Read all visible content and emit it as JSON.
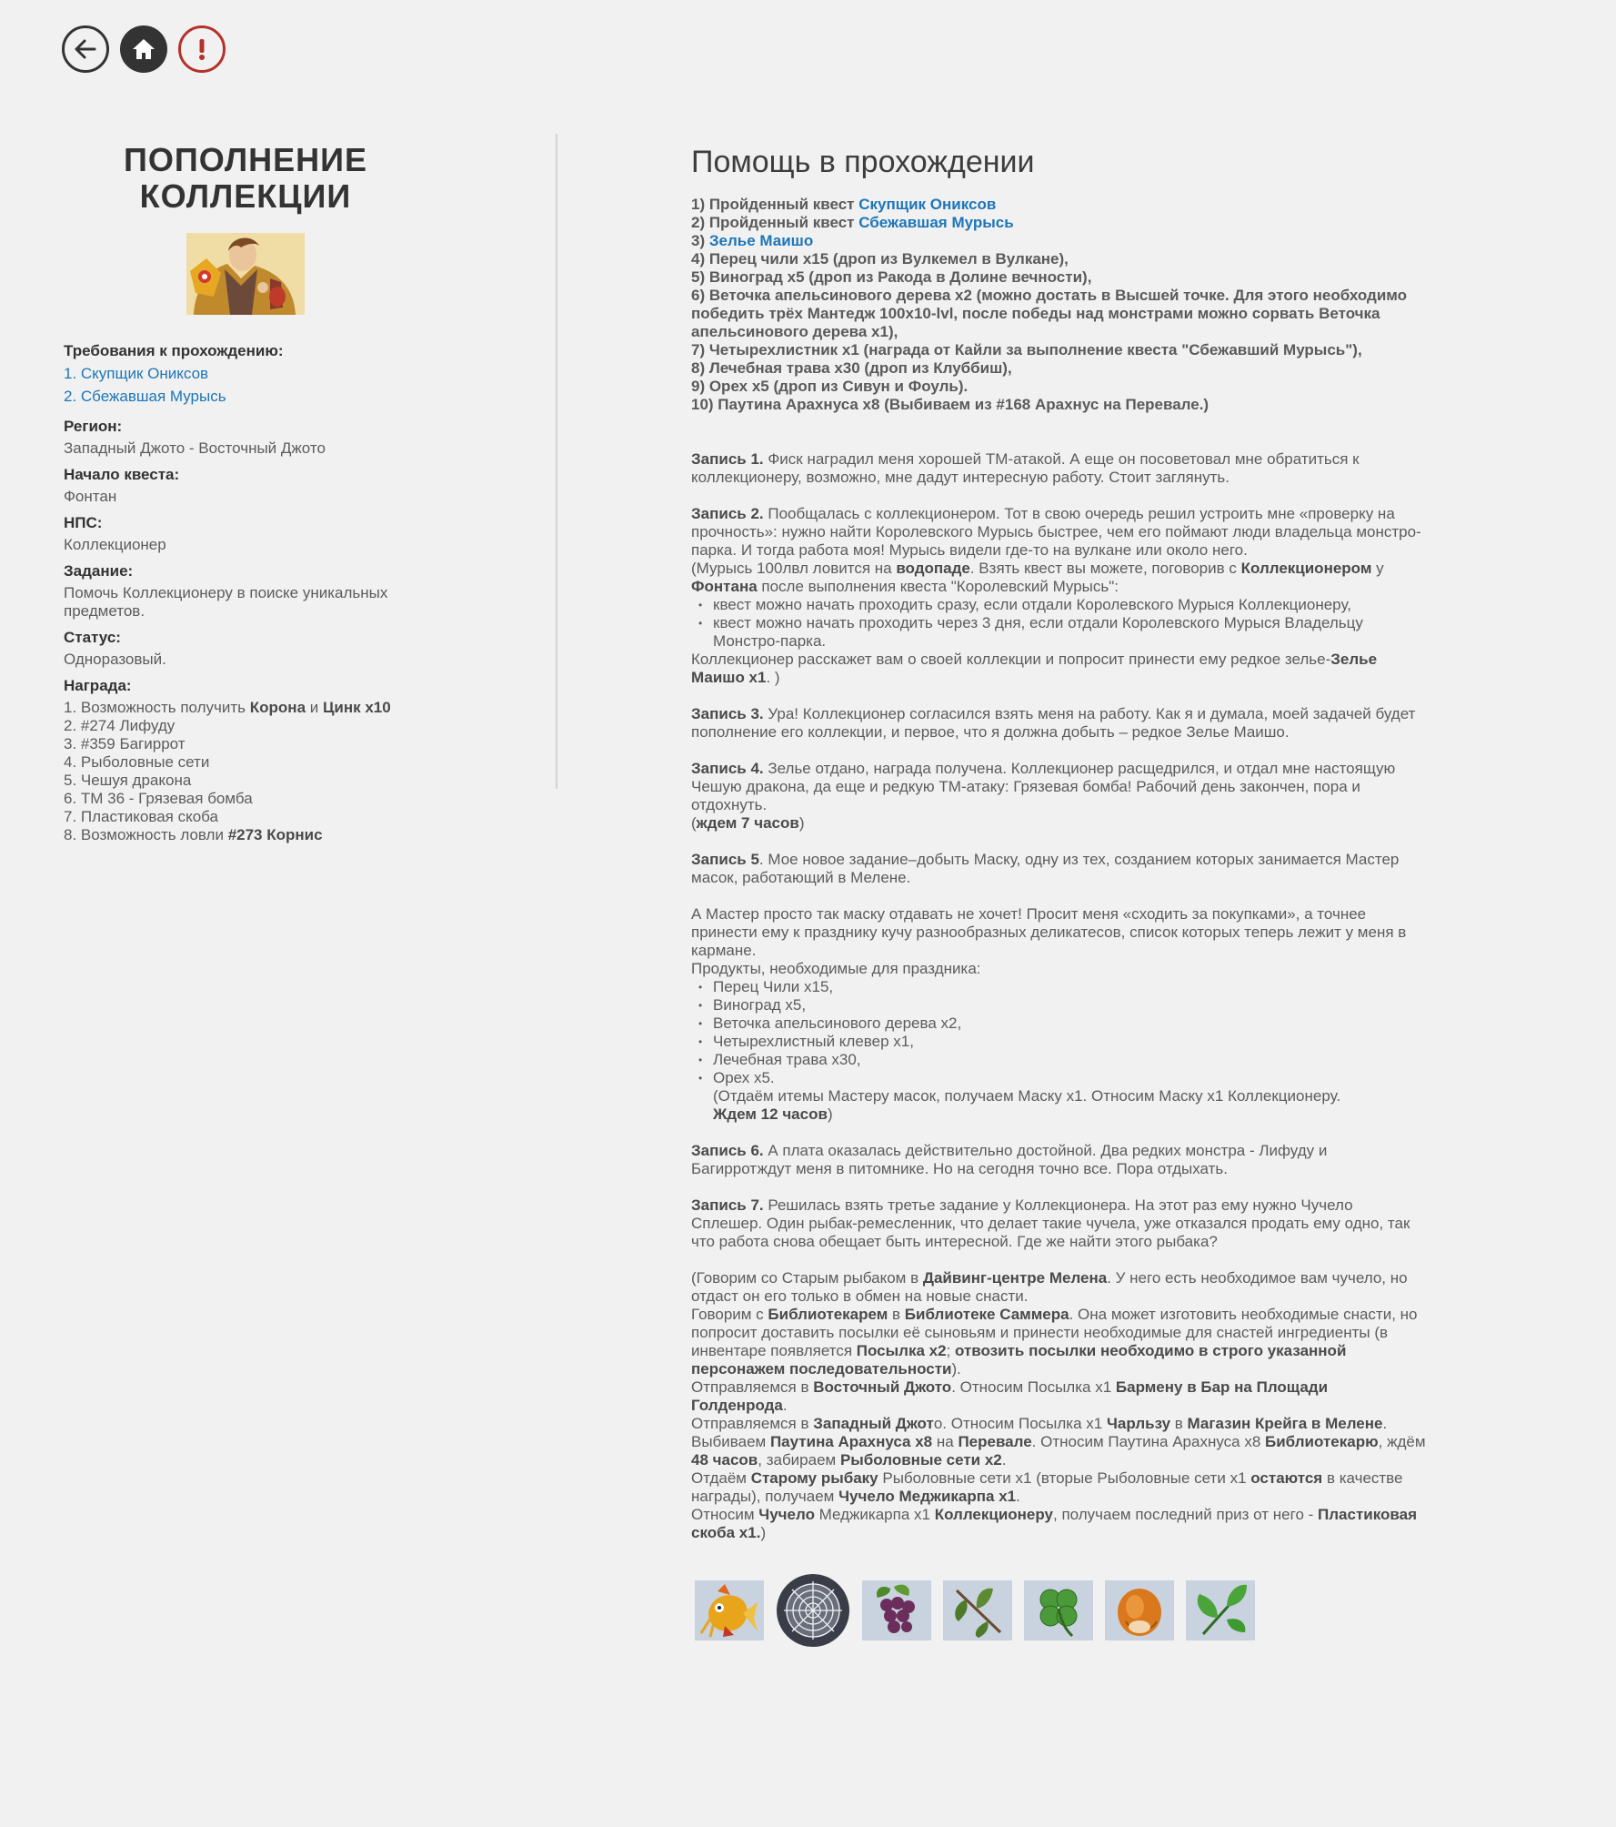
{
  "nav": {
    "back_icon": "arrow-left-icon",
    "home_icon": "home-icon",
    "alert_icon": "exclamation-icon"
  },
  "left": {
    "title_line1": "ПОПОЛНЕНИЕ",
    "title_line2": "КОЛЛЕКЦИИ",
    "requirements_label": "Требования к прохождению:",
    "requirements": [
      "1. Скупщик Ониксов",
      "2. Сбежавшая Мурысь"
    ],
    "region_label": "Регион:",
    "region": "Западный Джото - Восточный Джото",
    "start_label": "Начало квеста:",
    "start": "Фонтан",
    "npc_label": "НПС:",
    "npc": "Коллекционер",
    "task_label": "Задание:",
    "task": "Помочь Коллекционеру в поиске уникальных предметов.",
    "status_label": "Статус:",
    "status": "Одноразовый.",
    "reward_label": "Награда:",
    "reward": {
      "r1_a": "1. Возможность получить ",
      "r1_b": "Корона",
      "r1_c": " и ",
      "r1_d": "Цинк x10",
      "r2": "2. #274 Лифуду",
      "r3": "3. #359 Багиррот",
      "r4": "4.  Рыболовные сети",
      "r5": "5.  Чешуя дракона",
      "r6": "6.  ТМ 36 - Грязевая бомба",
      "r7": "7.  Пластиковая скоба",
      "r8_a": "8. Возможность ловли ",
      "r8_b": "#273 Корнис"
    }
  },
  "right": {
    "title": "Помощь в прохождении",
    "steps": {
      "s1_a": "1) Пройденный квест ",
      "s1_link": "Скупщик Ониксов",
      "s2_a": "2) Пройденный квест ",
      "s2_link": "Сбежавшая Мурысь",
      "s3_a": "3) ",
      "s3_link": "Зелье Маишо",
      "s4": "4) Перец чили x15 (дроп из Вулкемел в Вулкане),",
      "s5": "5) Виноград x5 (дроп из Ракода в Долине вечности),",
      "s6": "6) Веточка апельсинового дерева x2 (можно достать в Высшей точке. Для этого необходимо победить трёх Мантедж 100x10-lvl, после победы над монстрами можно сорвать Веточка апельсинового дерева x1),",
      "s7": "7) Четырехлистник x1 (награда от Кайли за выполнение квеста \"Сбежавший Мурысь\"),",
      "s8": "8) Лечебная трава x30 (дроп из Клуббиш),",
      "s9": "9) Орех x5 (дроп из Сивун и Фоуль).",
      "s10": "10) Паутина Арахнуса x8 (Выбиваем из #168 Арахнус на Перевале.)"
    },
    "e1_label": "Запись 1.",
    "e1_text": " Фиск наградил меня хорошей ТМ-атакой. А еще он посоветовал мне обратиться к коллекционеру, возможно, мне дадут интересную работу. Стоит заглянуть.",
    "e2_label": "Запись 2.",
    "e2_text": " Пообщалась с коллекционером. Тот в свою очередь решил устроить мне «проверку на прочность»: нужно найти Королевского Мурысь быстрее, чем его поймают люди владельца монстро-парка. И тогда работа моя! Мурысь видели где-то на вулкане или около него.",
    "e2_p2_a": "(Мурысь 100лвл ловится на ",
    "e2_p2_b": "водопаде",
    "e2_p2_c": ". Взять квест вы можете, поговорив с ",
    "e2_p2_d": "Коллекционером",
    "e2_p2_e": " у ",
    "e2_p2_f": "Фонтана",
    "e2_p2_g": " после выполнения квеста \"Королевский Мурысь\":",
    "e2_bullets": [
      "квест можно начать проходить сразу, если отдали Королевского Мурыся Коллекционеру,",
      "квест можно начать проходить через 3 дня, если отдали Королевского Мурыся Владельцу Монстро-парка."
    ],
    "e2_p3_a": "Коллекционер расскажет вам о своей коллекции и попросит принести ему редкое зелье-",
    "e2_p3_b": "Зелье Маишо x1",
    "e2_p3_c": ". )",
    "e3_label": "Запись 3.",
    "e3_text": " Ура! Коллекционер согласился взять меня на работу. Как я и думала, моей задачей будет пополнение его коллекции, и первое, что я должна добыть – редкое Зелье Маишо.",
    "e4_label": "Запись 4.",
    "e4_text": " Зелье отдано, награда получена. Коллекционер расщедрился, и отдал мне настоящую Чешую дракона, да еще и редкую ТМ-атаку: Грязевая бомба! Рабочий день закончен, пора и отдохнуть.",
    "e4_wait_a": "(",
    "e4_wait_b": "ждем 7 часов",
    "e4_wait_c": ")",
    "e5_label": "Запись 5",
    "e5_text": ". Мое новое задание–добыть Маску, одну из тех, созданием которых занимается Мастер масок, работающий в Мелене.",
    "e5_p2": "А Мастер просто так маску отдавать не хочет! Просит меня «сходить за покупками», а точнее принести ему к празднику кучу разнообразных деликатесов, список которых теперь лежит у меня в кармане.",
    "e5_p3": "Продукты, необходимые для праздника:",
    "e5_bullets": [
      "Перец Чили x15,",
      "Виноград x5,",
      "Веточка апельсинового дерева x2,",
      "Четырехлистный клевер x1,",
      "Лечебная трава x30,",
      "Орех x5."
    ],
    "e5_note": "(Отдаём итемы Мастеру масок, получаем Маску x1. Относим Маску x1 Коллекционеру.",
    "e5_wait_b": "Ждем 12 часов",
    "e5_wait_c": ")",
    "e6_label": "Запись 6.",
    "e6_text": " А плата оказалась действительно достойной. Два редких монстра - Лифуду и Багирротждут меня в питомнике. Но на сегодня точно все. Пора отдыхать.",
    "e7_label": "Запись 7.",
    "e7_text": " Решилась взять третье задание у Коллекционера. На этот раз ему нужно Чучело Сплешер. Один рыбак-ремесленник, что делает такие чучела, уже отказался продать ему одно, так что работа снова обещает быть интересной. Где же найти этого рыбака?",
    "g1_a": "(Говорим со Старым рыбаком в ",
    "g1_b": "Дайвинг-центре Мелена",
    "g1_c": ". У него есть необходимое вам чучело, но отдаст он его только в обмен на новые снасти.",
    "g2_a": "Говорим с ",
    "g2_b": "Библиотекарем",
    "g2_c": " в ",
    "g2_d": "Библиотеке Саммера",
    "g2_e": ". Она может изготовить необходимые снасти, но попросит доставить посылки её сыновьям и принести необходимые для снастей ингредиенты (в инвентаре появляется ",
    "g2_f": "Посылка x2",
    "g2_g": "; ",
    "g2_h": "отвозить посылки необходимо в строго указанной персонажем последовательности",
    "g2_i": ").",
    "g3_a": "Отправляемся в ",
    "g3_b": "Восточный Джото",
    "g3_c": ". Относим Посылка x1 ",
    "g3_d": "Бармену в Бар на Площади Голденрода",
    "g3_e": ".",
    "g4_a": "Отправляемся в ",
    "g4_b": "Западный Джот",
    "g4_c": "о. Относим Посылка x1 ",
    "g4_d": "Чарльзу",
    "g4_e": " в ",
    "g4_f": "Магазин Крейга в Мелене",
    "g4_g": ".",
    "g5_a": "Выбиваем ",
    "g5_b": "Паутина Арахнуса x8",
    "g5_c": " на ",
    "g5_d": "Перевале",
    "g5_e": ". Относим Паутина Арахнуса x8 ",
    "g5_f": "Библиотекарю",
    "g5_g": ", ждём ",
    "g5_h": "48 часов",
    "g5_i": ", забираем ",
    "g5_j": "Рыболовные сети x2",
    "g5_k": ".",
    "g6_a": "Отдаём ",
    "g6_b": "Старому рыбаку",
    "g6_c": " Рыболовные сети x1 (вторые Рыболовные сети x1 ",
    "g6_d": "остаются",
    "g6_e": " в качестве награды), получаем ",
    "g6_f": "Чучело Меджикарпа x1",
    "g6_g": ".",
    "g7_a": "Относим ",
    "g7_b": "Чучело",
    "g7_c": " Меджикарпа x1 ",
    "g7_d": "Коллекционеру",
    "g7_e": ", получаем последний приз от него - ",
    "g7_f": "Пластиковая скоба x1.",
    "g7_g": ")"
  },
  "items": [
    "magikarp-figure-icon",
    "spider-web-icon",
    "grapes-icon",
    "orange-twig-icon",
    "four-leaf-clover-icon",
    "nut-icon",
    "healing-herb-icon"
  ],
  "colors": {
    "link": "#1d76b9",
    "alert": "#b5312b",
    "text": "#5c5c5c"
  }
}
